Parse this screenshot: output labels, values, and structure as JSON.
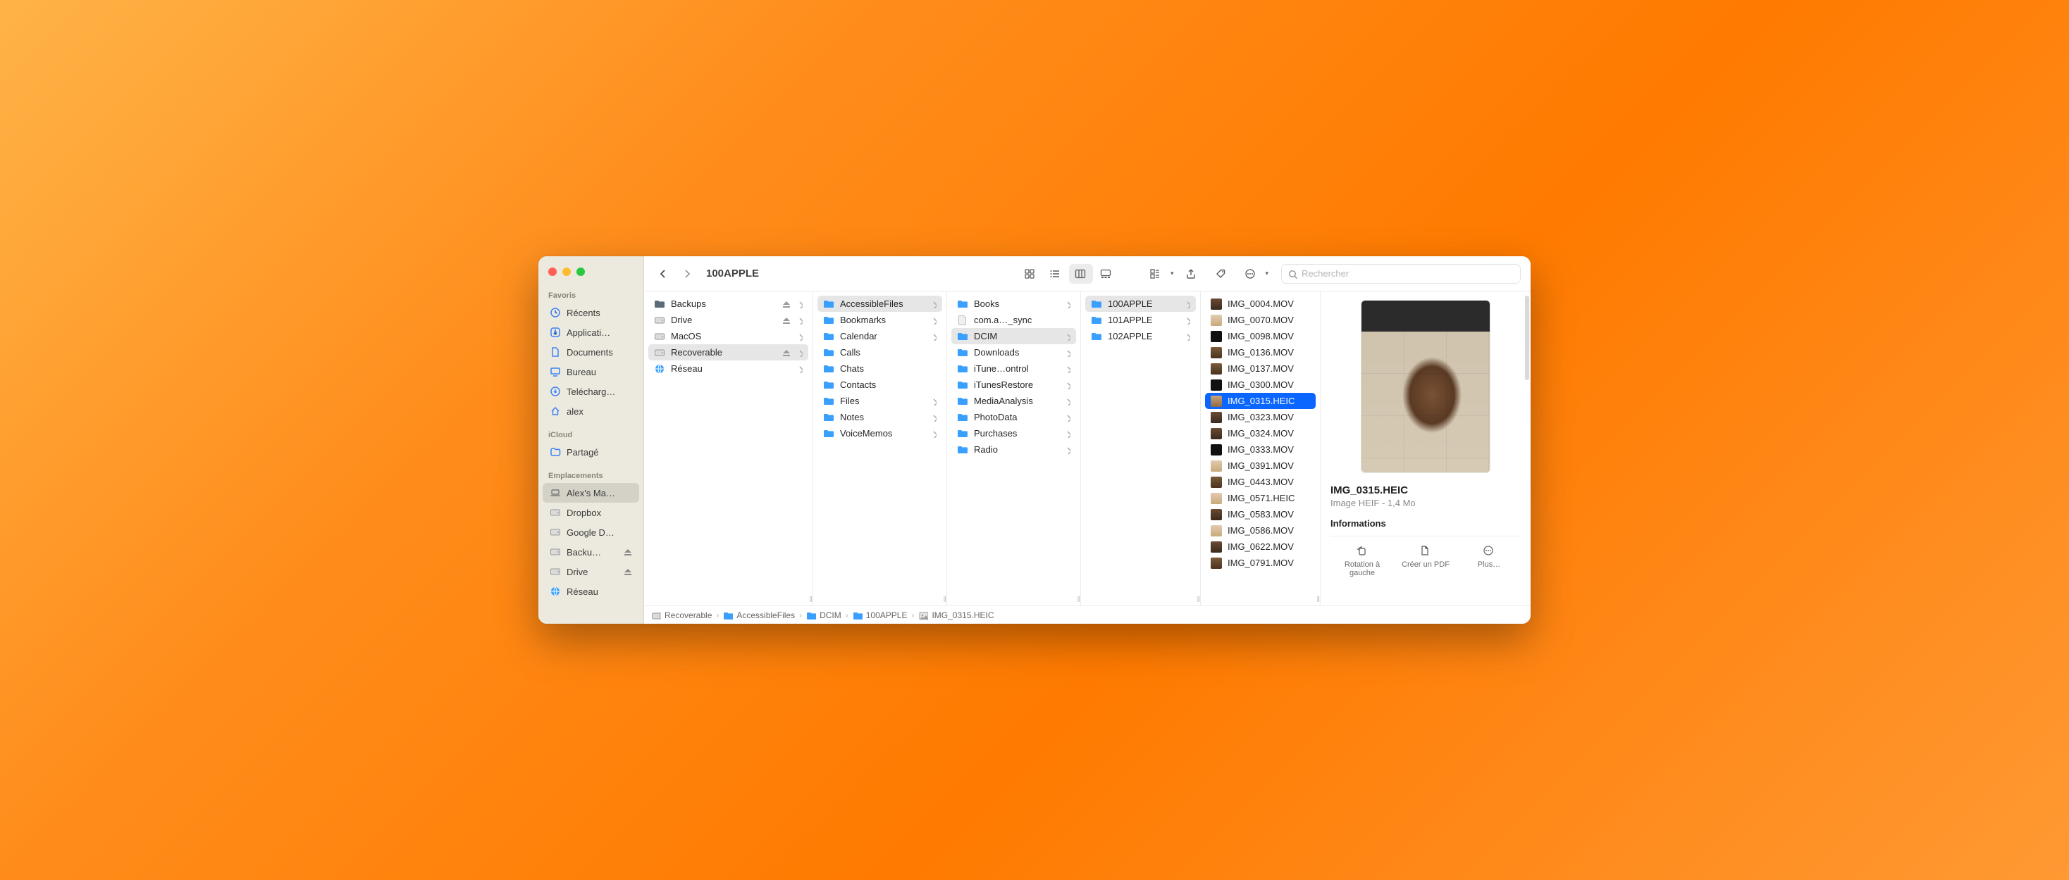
{
  "window": {
    "title": "100APPLE"
  },
  "search": {
    "placeholder": "Rechercher"
  },
  "sidebar": {
    "sections": [
      {
        "label": "Favoris",
        "items": [
          {
            "icon": "clock",
            "label": "Récents"
          },
          {
            "icon": "app",
            "label": "Applicati…"
          },
          {
            "icon": "doc",
            "label": "Documents"
          },
          {
            "icon": "desktop",
            "label": "Bureau"
          },
          {
            "icon": "download",
            "label": "Telécharg…"
          },
          {
            "icon": "home",
            "label": "alex"
          }
        ]
      },
      {
        "label": "iCloud",
        "items": [
          {
            "icon": "shared",
            "label": "Partagé"
          }
        ]
      },
      {
        "label": "Emplacements",
        "items": [
          {
            "icon": "laptop",
            "label": "Alex's Ma…",
            "selected": true
          },
          {
            "icon": "drive",
            "label": "Dropbox"
          },
          {
            "icon": "drive",
            "label": "Google D…"
          },
          {
            "icon": "drive",
            "label": "Backu…",
            "eject": true
          },
          {
            "icon": "drive",
            "label": "Drive",
            "eject": true
          },
          {
            "icon": "globe",
            "label": "Réseau"
          }
        ]
      }
    ]
  },
  "columns": [
    {
      "width": "col0",
      "items": [
        {
          "kind": "folder-dark",
          "label": "Backups",
          "chev": true,
          "eject": true
        },
        {
          "kind": "drive",
          "label": "Drive",
          "chev": true,
          "eject": true
        },
        {
          "kind": "drive",
          "label": "MacOS",
          "chev": true
        },
        {
          "kind": "drive",
          "label": "Recoverable",
          "chev": true,
          "eject": true,
          "selected": "path"
        },
        {
          "kind": "globe",
          "label": "Réseau",
          "chev": true
        }
      ]
    },
    {
      "width": "col1",
      "items": [
        {
          "kind": "folder",
          "label": "AccessibleFiles",
          "chev": true,
          "selected": "path"
        },
        {
          "kind": "folder",
          "label": "Bookmarks",
          "chev": true
        },
        {
          "kind": "folder",
          "label": "Calendar",
          "chev": true
        },
        {
          "kind": "folder",
          "label": "Calls"
        },
        {
          "kind": "folder",
          "label": "Chats"
        },
        {
          "kind": "folder",
          "label": "Contacts"
        },
        {
          "kind": "folder",
          "label": "Files",
          "chev": true
        },
        {
          "kind": "folder",
          "label": "Notes",
          "chev": true
        },
        {
          "kind": "folder",
          "label": "VoiceMemos",
          "chev": true
        }
      ]
    },
    {
      "width": "col2",
      "items": [
        {
          "kind": "folder",
          "label": "Books",
          "chev": true
        },
        {
          "kind": "file",
          "label": "com.a…_sync"
        },
        {
          "kind": "folder",
          "label": "DCIM",
          "chev": true,
          "selected": "path"
        },
        {
          "kind": "folder",
          "label": "Downloads",
          "chev": true
        },
        {
          "kind": "folder",
          "label": "iTune…ontrol",
          "chev": true
        },
        {
          "kind": "folder",
          "label": "iTunesRestore",
          "chev": true
        },
        {
          "kind": "folder",
          "label": "MediaAnalysis",
          "chev": true
        },
        {
          "kind": "folder",
          "label": "PhotoData",
          "chev": true
        },
        {
          "kind": "folder",
          "label": "Purchases",
          "chev": true
        },
        {
          "kind": "folder",
          "label": "Radio",
          "chev": true
        }
      ]
    },
    {
      "width": "col3",
      "items": [
        {
          "kind": "folder",
          "label": "100APPLE",
          "chev": true,
          "selected": "path"
        },
        {
          "kind": "folder",
          "label": "101APPLE",
          "chev": true
        },
        {
          "kind": "folder",
          "label": "102APPLE",
          "chev": true
        }
      ]
    },
    {
      "width": "col4",
      "items": [
        {
          "kind": "thumb",
          "tclass": "v1",
          "label": "IMG_0004.MOV"
        },
        {
          "kind": "thumb",
          "tclass": "v2",
          "label": "IMG_0070.MOV"
        },
        {
          "kind": "thumb",
          "tclass": "v3",
          "label": "IMG_0098.MOV"
        },
        {
          "kind": "thumb",
          "tclass": "v4",
          "label": "IMG_0136.MOV"
        },
        {
          "kind": "thumb",
          "tclass": "v4",
          "label": "IMG_0137.MOV"
        },
        {
          "kind": "thumb",
          "tclass": "v3",
          "label": "IMG_0300.MOV"
        },
        {
          "kind": "thumb",
          "tclass": "vsel",
          "label": "IMG_0315.HEIC",
          "selected": "active"
        },
        {
          "kind": "thumb",
          "tclass": "v1",
          "label": "IMG_0323.MOV"
        },
        {
          "kind": "thumb",
          "tclass": "v1",
          "label": "IMG_0324.MOV"
        },
        {
          "kind": "thumb",
          "tclass": "v3",
          "label": "IMG_0333.MOV"
        },
        {
          "kind": "thumb",
          "tclass": "v2",
          "label": "IMG_0391.MOV"
        },
        {
          "kind": "thumb",
          "tclass": "v4",
          "label": "IMG_0443.MOV"
        },
        {
          "kind": "thumb",
          "tclass": "v2",
          "label": "IMG_0571.HEIC"
        },
        {
          "kind": "thumb",
          "tclass": "v1",
          "label": "IMG_0583.MOV"
        },
        {
          "kind": "thumb",
          "tclass": "v2",
          "label": "IMG_0586.MOV"
        },
        {
          "kind": "thumb",
          "tclass": "v1",
          "label": "IMG_0622.MOV"
        },
        {
          "kind": "thumb",
          "tclass": "v4",
          "label": "IMG_0791.MOV"
        }
      ]
    }
  ],
  "preview": {
    "filename": "IMG_0315.HEIC",
    "meta": "Image HEIF - 1,4 Mo",
    "info_label": "Informations",
    "actions": [
      {
        "icon": "rotate",
        "label": "Rotation à gauche"
      },
      {
        "icon": "pdf",
        "label": "Créer un PDF"
      },
      {
        "icon": "more",
        "label": "Plus…"
      }
    ]
  },
  "pathbar": [
    {
      "icon": "drive",
      "label": "Recoverable"
    },
    {
      "icon": "folder",
      "label": "AccessibleFiles"
    },
    {
      "icon": "folder",
      "label": "DCIM"
    },
    {
      "icon": "folder",
      "label": "100APPLE"
    },
    {
      "icon": "image",
      "label": "IMG_0315.HEIC"
    }
  ]
}
